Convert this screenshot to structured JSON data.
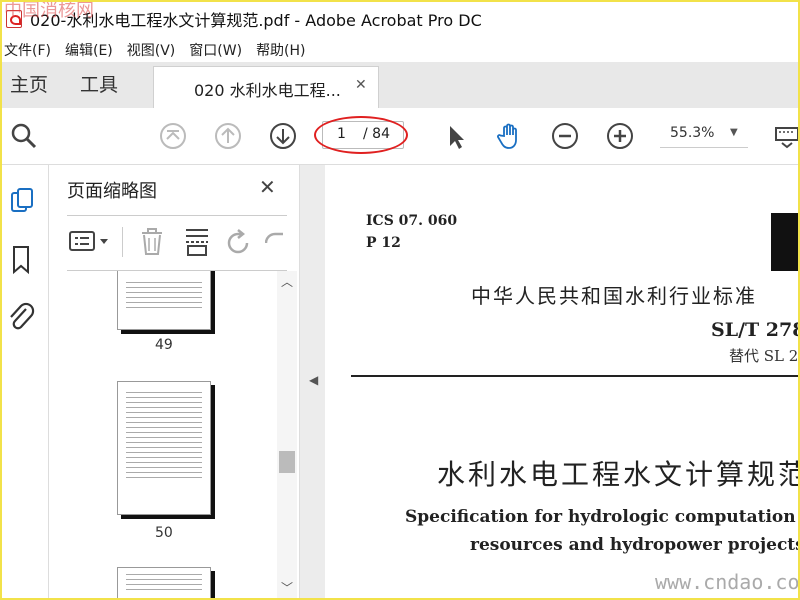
{
  "window": {
    "title": "020-水利水电工程水文计算规范.pdf - Adobe Acrobat Pro DC",
    "watermark_top": "中国消核网"
  },
  "menu": {
    "items": [
      "文件(F)",
      "编辑(E)",
      "视图(V)",
      "窗口(W)",
      "帮助(H)"
    ]
  },
  "tabs": {
    "home": "主页",
    "tools": "工具",
    "document": "020 水利水电工程..."
  },
  "toolbar": {
    "current_page": "1",
    "total_pages": "/ 84",
    "zoom": "55.3%",
    "icons": [
      "search-icon",
      "first-page-icon",
      "prev-page-icon",
      "next-page-icon",
      "select-arrow-icon",
      "hand-icon",
      "zoom-out-icon",
      "zoom-in-icon",
      "keyboard-icon"
    ]
  },
  "thumbnail_panel": {
    "title": "页面缩略图",
    "pages": [
      "49",
      "50"
    ]
  },
  "document": {
    "ics": "ICS 07. 060",
    "pnum": "P 12",
    "standard_name": "中华人民共和国水利行业标准",
    "code": "SL/T 278",
    "replaces": "替代 SL 2",
    "title_cn": "水利水电工程水文计算规范",
    "title_en_line1": "Specification for hydrologic computation of w",
    "title_en_line2": "resources and hydropower projects"
  },
  "watermark_bottom": "www.cndao.com",
  "colors": {
    "accent_red": "#e02020",
    "hand_blue": "#1a6fc2",
    "sidebar_blue": "#1a6fc2"
  }
}
